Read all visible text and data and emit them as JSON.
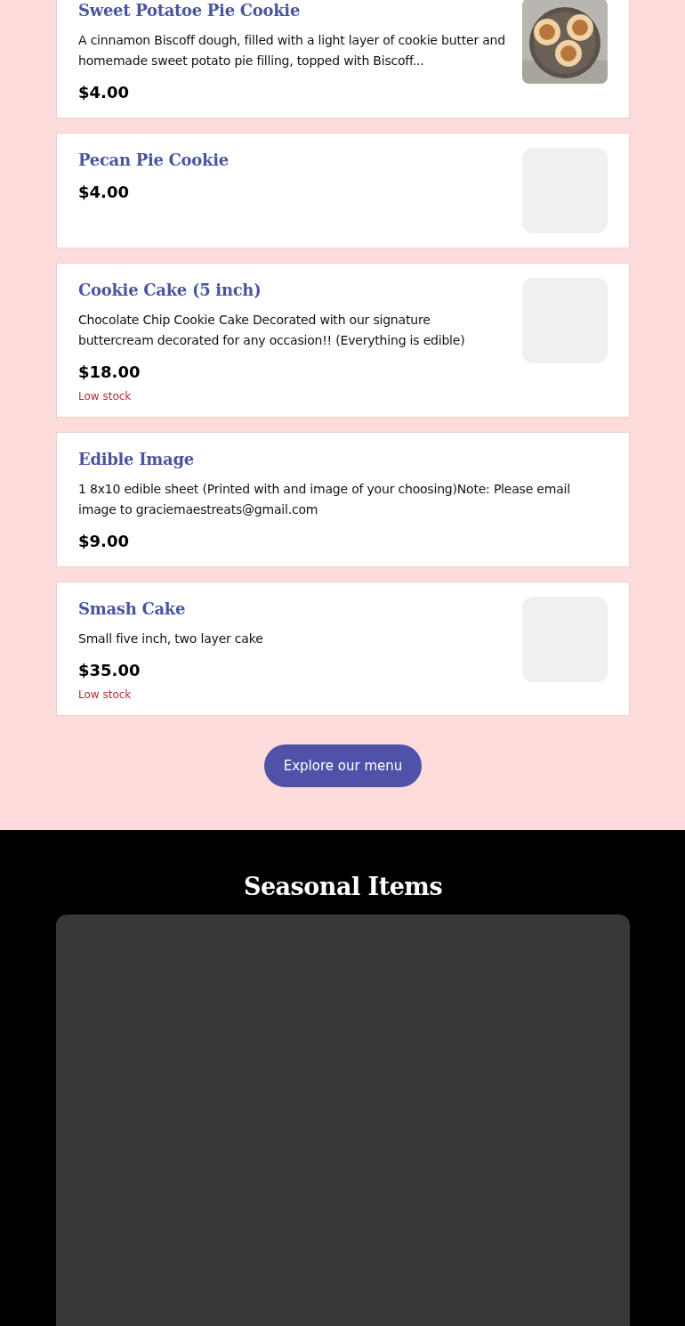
{
  "menu_items": [
    {
      "title": "Sweet Potatoe Pie Cookie",
      "description": "A cinnamon Biscoff dough, filled with a light layer of cookie butter and homemade sweet potato pie filling, topped with Biscoff...",
      "price": "$4.00",
      "kind": "picture"
    },
    {
      "title": "Pecan Pie Cookie",
      "price": "$4.00",
      "kind": "placeholder"
    },
    {
      "title": "Cookie Cake (5 inch)",
      "description": "Chocolate Chip Cookie Cake Decorated with our signature buttercream decorated for any occasion!! (Everything is edible)",
      "price": "$18.00",
      "stock_note": "Low stock",
      "kind": "placeholder"
    },
    {
      "title": "Edible Image",
      "description": "1 8x10 edible sheet (Printed with and image of your choosing)Note: Please email image to graciemaestreats@gmail.com",
      "price": "$9.00",
      "kind": "text"
    },
    {
      "title": "Smash Cake",
      "description": "Small five inch, two layer cake",
      "price": "$35.00",
      "stock_note": "Low stock",
      "kind": "placeholder"
    }
  ],
  "explore_button": "Explore our menu",
  "seasonal": {
    "heading": "Seasonal Items"
  }
}
